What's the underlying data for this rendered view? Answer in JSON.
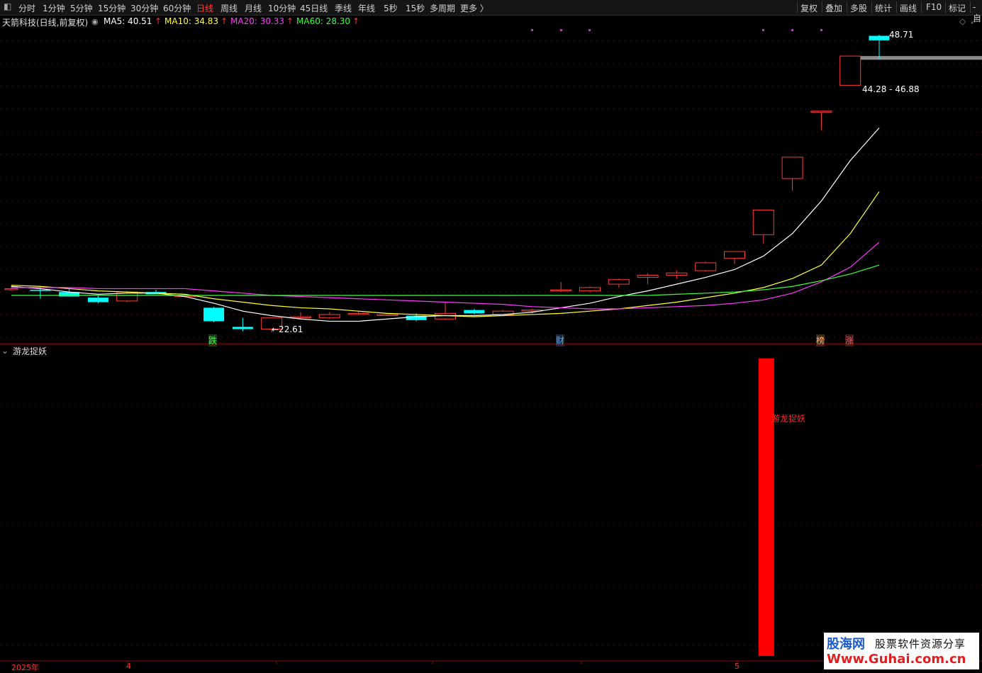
{
  "toolbar": {
    "periods": [
      "分时",
      "1分钟",
      "5分钟",
      "15分钟",
      "30分钟",
      "60分钟",
      "日线",
      "周线",
      "月线",
      "10分钟",
      "45日线",
      "季线",
      "年线",
      "5秒",
      "15秒",
      "多周期",
      "更多 〉"
    ],
    "active_period": "日线",
    "tools": [
      "复权",
      "叠加",
      "多股",
      "统计",
      "画线",
      "F10",
      "标记",
      "-自"
    ]
  },
  "header": {
    "stock": "天箭科技(日线,前复权)",
    "ma": [
      {
        "label": "MA5: 40.51",
        "color": "#ffffff"
      },
      {
        "label": "MA10: 34.83",
        "color": "#ffff3a"
      },
      {
        "label": "MA20: 30.33",
        "color": "#ff3aff"
      },
      {
        "label": "MA60: 28.30",
        "color": "#3aff3a"
      }
    ],
    "arrow": "↑"
  },
  "annotations": {
    "high": "48.71",
    "range": "44.28 - 46.88",
    "low": "←22.61",
    "tags": [
      {
        "text": "跌",
        "color": "#3aff3a"
      },
      {
        "text": "财",
        "color": "#4da6ff"
      },
      {
        "text": "榜",
        "color": "#ffb366"
      },
      {
        "text": "涨",
        "color": "#ff4d4d"
      }
    ]
  },
  "sub_panel": {
    "title": "游龙捉妖",
    "signal_label": "游龙捉妖"
  },
  "x_axis": {
    "year": "2025年",
    "month1": "4",
    "month2": "5"
  },
  "watermark": {
    "brand": "股海网",
    "slogan": "股票软件资源分享",
    "url": "Www.Guhai.com.cn"
  },
  "chart_data": {
    "type": "candlestick",
    "title": "天箭科技(日线,前复权)",
    "y_visible_range": [
      21.5,
      50.5
    ],
    "candles": [
      {
        "o": 26.2,
        "h": 26.5,
        "l": 26.0,
        "c": 26.2
      },
      {
        "o": 26.1,
        "h": 26.4,
        "l": 25.3,
        "c": 26.0
      },
      {
        "o": 25.9,
        "h": 26.2,
        "l": 25.6,
        "c": 25.5
      },
      {
        "o": 25.4,
        "h": 25.6,
        "l": 24.9,
        "c": 25.0
      },
      {
        "o": 25.1,
        "h": 26.0,
        "l": 25.0,
        "c": 25.9
      },
      {
        "o": 25.9,
        "h": 26.1,
        "l": 25.7,
        "c": 25.7
      },
      {
        "o": 25.6,
        "h": 25.7,
        "l": 25.4,
        "c": 25.6
      },
      {
        "o": 24.5,
        "h": 24.6,
        "l": 23.2,
        "c": 23.3
      },
      {
        "o": 22.8,
        "h": 23.6,
        "l": 22.4,
        "c": 22.6
      },
      {
        "o": 22.6,
        "h": 23.2,
        "l": 22.3,
        "c": 23.6
      },
      {
        "o": 23.7,
        "h": 24.1,
        "l": 23.5,
        "c": 23.7
      },
      {
        "o": 23.6,
        "h": 24.1,
        "l": 23.5,
        "c": 23.9
      },
      {
        "o": 24.0,
        "h": 24.2,
        "l": 23.9,
        "c": 24.0
      },
      {
        "o": 23.9,
        "h": 24.0,
        "l": 23.8,
        "c": 23.9
      },
      {
        "o": 23.8,
        "h": 24.0,
        "l": 23.3,
        "c": 23.4
      },
      {
        "o": 23.5,
        "h": 25.0,
        "l": 23.4,
        "c": 24.0
      },
      {
        "o": 24.3,
        "h": 24.4,
        "l": 23.9,
        "c": 24.0
      },
      {
        "o": 23.9,
        "h": 24.3,
        "l": 23.8,
        "c": 24.2
      },
      {
        "o": 24.2,
        "h": 24.4,
        "l": 24.0,
        "c": 24.3
      },
      {
        "o": 26.1,
        "h": 26.8,
        "l": 25.9,
        "c": 26.1
      },
      {
        "o": 26.0,
        "h": 26.4,
        "l": 25.9,
        "c": 26.3
      },
      {
        "o": 26.6,
        "h": 27.1,
        "l": 26.3,
        "c": 27.0
      },
      {
        "o": 27.2,
        "h": 27.6,
        "l": 26.6,
        "c": 27.4
      },
      {
        "o": 27.4,
        "h": 27.8,
        "l": 27.1,
        "c": 27.6
      },
      {
        "o": 27.8,
        "h": 28.6,
        "l": 27.7,
        "c": 28.5
      },
      {
        "o": 28.9,
        "h": 29.2,
        "l": 28.4,
        "c": 29.5
      },
      {
        "o": 31.0,
        "h": 31.2,
        "l": 30.2,
        "c": 33.2
      },
      {
        "o": 36.0,
        "h": 36.0,
        "l": 34.9,
        "c": 37.9
      },
      {
        "o": 42.0,
        "h": 42.0,
        "l": 40.3,
        "c": 42.0
      },
      {
        "o": 44.3,
        "h": 46.9,
        "l": 44.3,
        "c": 46.9
      },
      {
        "o": 48.7,
        "h": 48.8,
        "l": 46.6,
        "c": 48.3
      }
    ],
    "ma_series": [
      {
        "name": "MA5",
        "color": "#ffffff",
        "values": [
          26.4,
          26.2,
          25.9,
          25.7,
          25.8,
          25.8,
          25.5,
          24.9,
          24.2,
          23.8,
          23.5,
          23.3,
          23.3,
          23.5,
          23.7,
          23.8,
          23.8,
          23.9,
          24.1,
          24.5,
          24.9,
          25.5,
          26.0,
          26.6,
          27.2,
          27.9,
          29.1,
          31.1,
          34.0,
          37.6,
          40.51
        ]
      },
      {
        "name": "MA10",
        "color": "#ffff3a",
        "values": [
          26.5,
          26.4,
          26.2,
          26.0,
          25.9,
          25.8,
          25.7,
          25.3,
          25.0,
          24.7,
          24.5,
          24.4,
          24.2,
          24.0,
          23.9,
          23.8,
          23.7,
          23.8,
          23.9,
          24.0,
          24.2,
          24.4,
          24.7,
          25.0,
          25.4,
          25.8,
          26.3,
          27.1,
          28.3,
          31.1,
          34.83
        ]
      },
      {
        "name": "MA20",
        "color": "#ff3aff",
        "values": [
          26.3,
          26.3,
          26.3,
          26.2,
          26.2,
          26.2,
          26.2,
          26.0,
          25.8,
          25.6,
          25.5,
          25.4,
          25.3,
          25.2,
          25.1,
          25.0,
          24.9,
          24.8,
          24.6,
          24.5,
          24.4,
          24.4,
          24.5,
          24.6,
          24.7,
          24.9,
          25.2,
          25.8,
          26.8,
          28.1,
          30.33
        ]
      },
      {
        "name": "MA60",
        "color": "#3aff3a",
        "values": [
          25.6,
          25.6,
          25.6,
          25.6,
          25.6,
          25.6,
          25.6,
          25.6,
          25.6,
          25.6,
          25.6,
          25.6,
          25.6,
          25.6,
          25.6,
          25.6,
          25.6,
          25.6,
          25.6,
          25.6,
          25.6,
          25.6,
          25.6,
          25.7,
          25.8,
          25.9,
          26.1,
          26.4,
          26.9,
          27.5,
          28.3
        ]
      }
    ],
    "indicator": {
      "name": "游龙捉妖",
      "signal_index": 26
    }
  }
}
